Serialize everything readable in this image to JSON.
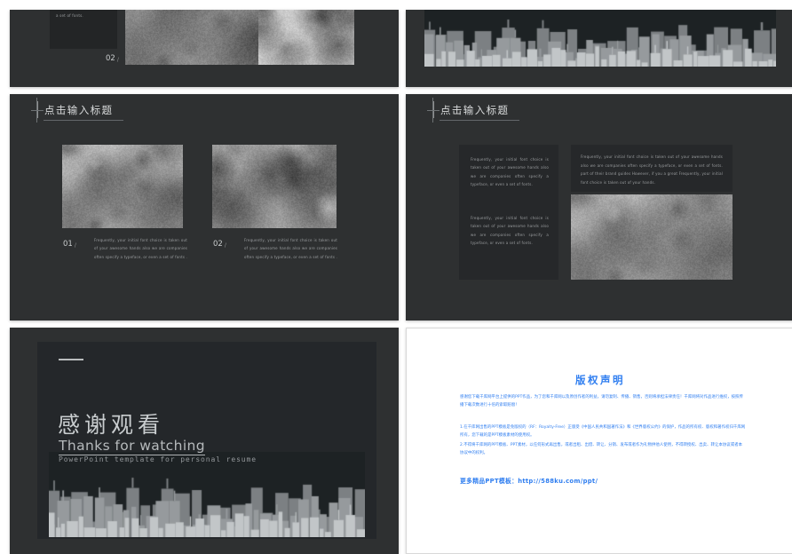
{
  "meta": {
    "page_background": "#ffffff",
    "slide_background": "#2e3031",
    "accent_blue": "#2f7ef0",
    "text_gray": "#9a9d9f"
  },
  "slides": {
    "slide1": {
      "name": "team-meeting-slide",
      "body_text": "awesome hands also we are companies often specify a typeface, or even a set of fonts.",
      "number": "02",
      "slash": "/",
      "photo1_alt": "business-team-meeting-photo",
      "photo2_alt": "hand-writing-chart-photo"
    },
    "slide2": {
      "name": "city-skyline-slide",
      "skyline_alt": "city-skyline-silhouette"
    },
    "slide3": {
      "name": "two-column-photo-slide",
      "title": "点击输入标题",
      "items": [
        {
          "number": "01",
          "slash": "/",
          "text": "Frequently, your initial font choice is taken out of your awesome hands also we are companies often specify a typeface, or even a set of fonts .",
          "photo_alt": "hands-on-laptop-keyboard-photo"
        },
        {
          "number": "02",
          "slash": "/",
          "text": "Frequently, your initial font choice is taken out of your awesome hands also we are companies often specify a typeface, or even a set of fonts .",
          "photo_alt": "business-people-thumbs-up-photo"
        }
      ]
    },
    "slide4": {
      "name": "text-panels-slide",
      "title": "点击输入标题",
      "left_para1": "Frequently, your initial font choice is taken out of your awesome hands also we are companies often specify a typeface, or even a set of fonts.",
      "left_para2": "Frequently, your initial font choice is taken out of your awesome hands also we are companies often specify a typeface, or even a set of fonts.",
      "right_para": "Frequently, your initial font choice is taken out of your awesome hands also we are companies often specify a typeface, or even a set of fonts. part of their brand guides However, if you a great Frequently, your initial font choice is taken out of your hands.",
      "photo_alt": "raised-fists-teamwork-photo"
    },
    "slide5": {
      "name": "thank-you-slide",
      "heading_cn": "感谢观看",
      "heading_en": "Thanks for watching",
      "subtitle": "PowerPoint template for personal resume",
      "skyline_alt": "city-skyline-silhouette"
    },
    "slide6": {
      "name": "copyright-notice-slide",
      "title": "版权声明",
      "paragraph1": "感谢您下载千库网平台上提供的PPT作品，为了您和千库网以及原创作者的利益，请勿复制、传播、销售，否则将承担法律责任！千库网将对作品进行维权，按照传播下载次数进行十倍的索取赔偿！",
      "paragraph2_line1": "1.在千库网出售的PPT模板是免版权的（RF：Royalty-Free）正版受《中国人民共和国著作法》和《世界版权公约》的保护，作品的所有权、版权和著作权归千库网所有，您下载的是PPT模板素材的使用权。",
      "paragraph2_line2": "2.不得将千库网的PPT模板、PPT素材，以任何形式再出售，或者出租、出借、转让、分销、发布或者作为礼物供他人使用，不得转授权、出卖、转让本协议或者本协议中的权利。",
      "link_label": "更多精品PPT模板：",
      "link_url": "http://588ku.com/ppt/"
    }
  }
}
